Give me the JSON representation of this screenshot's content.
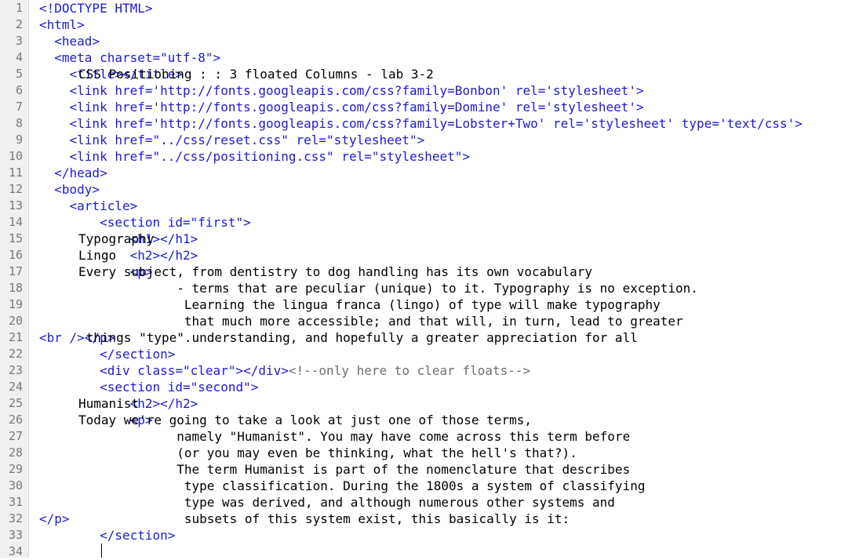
{
  "editor": {
    "lines": [
      {
        "number": "1",
        "tokens": [
          {
            "t": "tag",
            "s": "<!DOCTYPE HTML>"
          }
        ]
      },
      {
        "number": "2",
        "tokens": [
          {
            "t": "tag",
            "s": "<html>"
          }
        ]
      },
      {
        "number": "3",
        "tokens": [
          {
            "t": "tag",
            "s": "  <head>"
          }
        ]
      },
      {
        "number": "4",
        "tokens": [
          {
            "t": "tag",
            "s": "  <meta charset=\"utf-8\">"
          }
        ]
      },
      {
        "number": "5",
        "tokens": [
          {
            "t": "tag",
            "s": "    <title>"
          },
          {
            "t": "txt",
            "s": "CSS Positioning : : 3 floated Columns - lab 3-2"
          },
          {
            "t": "tag",
            "s": "</title>"
          }
        ]
      },
      {
        "number": "6",
        "tokens": [
          {
            "t": "tag",
            "s": "    <link href='http://fonts.googleapis.com/css?family=Bonbon' rel='stylesheet'>"
          }
        ]
      },
      {
        "number": "7",
        "tokens": [
          {
            "t": "tag",
            "s": "    <link href='http://fonts.googleapis.com/css?family=Domine' rel='stylesheet'>"
          }
        ]
      },
      {
        "number": "8",
        "tokens": [
          {
            "t": "tag",
            "s": "    <link href='http://fonts.googleapis.com/css?family=Lobster+Two' rel='stylesheet' type='text/css'>"
          }
        ]
      },
      {
        "number": "9",
        "tokens": [
          {
            "t": "tag",
            "s": "    <link href=\"../css/reset.css\" rel=\"stylesheet\">"
          }
        ]
      },
      {
        "number": "10",
        "tokens": [
          {
            "t": "tag",
            "s": "    <link href=\"../css/positioning.css\" rel=\"stylesheet\">"
          }
        ]
      },
      {
        "number": "11",
        "tokens": [
          {
            "t": "tag",
            "s": "  </head>"
          }
        ]
      },
      {
        "number": "12",
        "tokens": [
          {
            "t": "tag",
            "s": "  <body>"
          }
        ]
      },
      {
        "number": "13",
        "tokens": [
          {
            "t": "tag",
            "s": "    <article>"
          }
        ]
      },
      {
        "number": "14",
        "tokens": [
          {
            "t": "tag",
            "s": "        <section id=\"first\">"
          }
        ]
      },
      {
        "number": "15",
        "tokens": [
          {
            "t": "tag",
            "s": "            <h1>"
          },
          {
            "t": "txt",
            "s": "Typography"
          },
          {
            "t": "tag",
            "s": "</h1>"
          }
        ]
      },
      {
        "number": "16",
        "tokens": [
          {
            "t": "tag",
            "s": "            <h2>"
          },
          {
            "t": "txt",
            "s": "Lingo"
          },
          {
            "t": "tag",
            "s": "</h2>"
          }
        ]
      },
      {
        "number": "17",
        "tokens": [
          {
            "t": "tag",
            "s": "            <p>"
          },
          {
            "t": "txt",
            "s": "Every subject, from dentistry to dog handling has its own vocabulary"
          }
        ]
      },
      {
        "number": "18",
        "tokens": [
          {
            "t": "txt",
            "s": "             - terms that are peculiar (unique) to it. Typography is no exception."
          }
        ]
      },
      {
        "number": "19",
        "tokens": [
          {
            "t": "txt",
            "s": "              Learning the lingua franca (lingo) of type will make typography"
          }
        ]
      },
      {
        "number": "20",
        "tokens": [
          {
            "t": "txt",
            "s": "              that much more accessible; and that will, in turn, lead to greater"
          }
        ]
      },
      {
        "number": "21",
        "tokens": [
          {
            "t": "txt",
            "s": "               understanding, and hopefully a greater appreciation for all"
          },
          {
            "t": "tag",
            "s": "<br />"
          },
          {
            "t": "txt",
            "s": " things \"type\"."
          },
          {
            "t": "tag",
            "s": "</p>"
          }
        ]
      },
      {
        "number": "22",
        "tokens": [
          {
            "t": "tag",
            "s": "        </section>"
          }
        ]
      },
      {
        "number": "23",
        "tokens": [
          {
            "t": "tag",
            "s": "        <div class=\"clear\"></div>"
          },
          {
            "t": "txt",
            "s": " "
          },
          {
            "t": "cmt",
            "s": "<!--only here to clear floats-->"
          }
        ]
      },
      {
        "number": "24",
        "tokens": [
          {
            "t": "tag",
            "s": "        <section id=\"second\">"
          }
        ]
      },
      {
        "number": "25",
        "tokens": [
          {
            "t": "tag",
            "s": "            <h2>"
          },
          {
            "t": "txt",
            "s": "Humanist"
          },
          {
            "t": "tag",
            "s": "</h2>"
          }
        ]
      },
      {
        "number": "26",
        "tokens": [
          {
            "t": "tag",
            "s": "            <p>"
          },
          {
            "t": "txt",
            "s": "Today we're going to take a look at just one of those terms,"
          }
        ]
      },
      {
        "number": "27",
        "tokens": [
          {
            "t": "txt",
            "s": "             namely \"Humanist\". You may have come across this term before"
          }
        ]
      },
      {
        "number": "28",
        "tokens": [
          {
            "t": "txt",
            "s": "             (or you may even be thinking, what the hell's that?)."
          }
        ]
      },
      {
        "number": "29",
        "tokens": [
          {
            "t": "txt",
            "s": "             The term Humanist is part of the nomenclature that describes"
          }
        ]
      },
      {
        "number": "30",
        "tokens": [
          {
            "t": "txt",
            "s": "              type classification. During the 1800s a system of classifying"
          }
        ]
      },
      {
        "number": "31",
        "tokens": [
          {
            "t": "txt",
            "s": "              type was derived, and although numerous other systems and"
          }
        ]
      },
      {
        "number": "32",
        "tokens": [
          {
            "t": "txt",
            "s": "              subsets of this system exist, this basically is it:"
          },
          {
            "t": "tag",
            "s": "</p>"
          }
        ]
      },
      {
        "number": "33",
        "tokens": [
          {
            "t": "tag",
            "s": "        </section>"
          }
        ]
      },
      {
        "number": "34",
        "tokens": [
          {
            "t": "txt",
            "s": ""
          }
        ]
      }
    ]
  }
}
